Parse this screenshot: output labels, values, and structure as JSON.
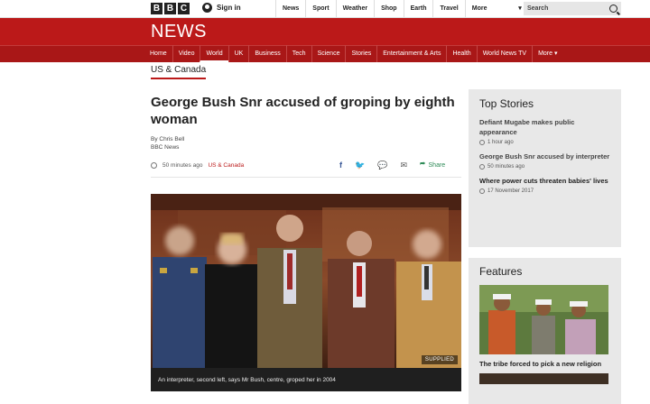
{
  "topbar": {
    "logo_letters": [
      "B",
      "B",
      "C"
    ],
    "signin_label": "Sign in",
    "nav": [
      "News",
      "Sport",
      "Weather",
      "Shop",
      "Earth",
      "Travel"
    ],
    "more_label": "More",
    "more_arrow": "▾",
    "search_placeholder": "Search"
  },
  "masthead": {
    "title": "NEWS",
    "nav": [
      "Home",
      "Video",
      "World",
      "UK",
      "Business",
      "Tech",
      "Science",
      "Stories",
      "Entertainment & Arts",
      "Health",
      "World News TV",
      "More ▾"
    ],
    "active_item": "World",
    "section": "US & Canada"
  },
  "article": {
    "headline": "George Bush Snr accused of groping by eighth woman",
    "author": "By Chris Bell",
    "source": "BBC News",
    "time": "50 minutes ago",
    "section_link": "US & Canada",
    "share": {
      "facebook": "f",
      "twitter": "🐦",
      "messenger": "💬",
      "email": "✉",
      "share_label": "Share",
      "share_icon": "⮫"
    },
    "image_badge": "SUPPLIED",
    "caption": "An interpreter, second left, says Mr Bush, centre, groped her in 2004"
  },
  "top_stories": {
    "heading": "Top Stories",
    "items": [
      {
        "title": "Defiant Mugabe makes public appearance",
        "time": "1 hour ago"
      },
      {
        "title": "George Bush Snr accused by interpreter",
        "time": "50 minutes ago"
      },
      {
        "title": "Where power cuts threaten babies' lives",
        "time": "17 November 2017"
      }
    ]
  },
  "features": {
    "heading": "Features",
    "items": [
      {
        "title": "The tribe forced to pick a new religion"
      }
    ]
  },
  "colors": {
    "brand_red": "#bb1919",
    "nav_red": "#a91717",
    "sidebar_bg": "#e8e8e8"
  }
}
